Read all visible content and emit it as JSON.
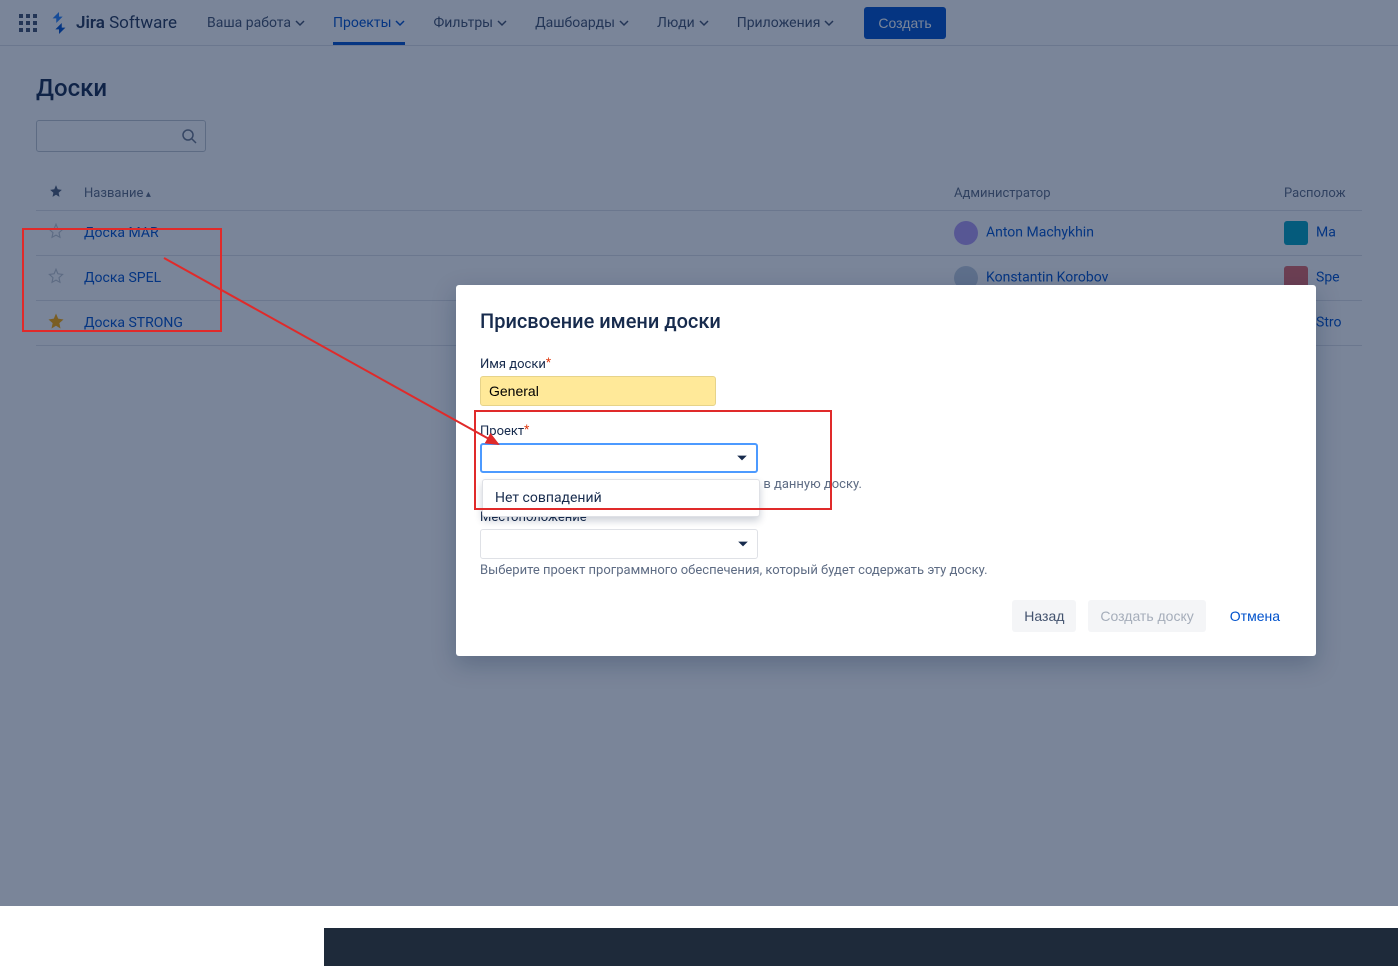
{
  "brand": {
    "name_a": "Jira",
    "name_b": "Software"
  },
  "nav": {
    "your_work": "Ваша работа",
    "projects": "Проекты",
    "filters": "Фильтры",
    "dashboards": "Дашбоарды",
    "people": "Люди",
    "apps": "Приложения",
    "create": "Создать"
  },
  "page": {
    "title": "Доски"
  },
  "table": {
    "col_name": "Название",
    "col_admin": "Администратор",
    "col_location": "Располож",
    "rows": [
      {
        "starred": false,
        "name": "Доска MAR",
        "admin": "Anton Machykhin",
        "avatar_bg": "#b49cf5",
        "loc": "Ma",
        "loc_bg": "#00a3bf"
      },
      {
        "starred": false,
        "name": "Доска SPEL",
        "admin": "Konstantin Korobov",
        "avatar_bg": "#c3d0e0",
        "loc": "Spe",
        "loc_bg": "#e06666"
      },
      {
        "starred": true,
        "name": "Доска STRONG",
        "admin": "",
        "avatar_bg": "#d7b7b0",
        "loc": "Stro",
        "loc_bg": "#7a5bd6"
      }
    ]
  },
  "modal": {
    "title": "Присвоение имени доски",
    "board_name_label": "Имя доски",
    "board_name_value": "General",
    "project_label": "Проект",
    "project_value": "",
    "project_nomatch": "Нет совпадений",
    "location_help_fragment": "ния в данную доску.",
    "location_label": "Местоположение",
    "location_help": "Выберите проект программного обеспечения, который будет содержать эту доску.",
    "back": "Назад",
    "create_board": "Создать доску",
    "cancel": "Отмена"
  }
}
